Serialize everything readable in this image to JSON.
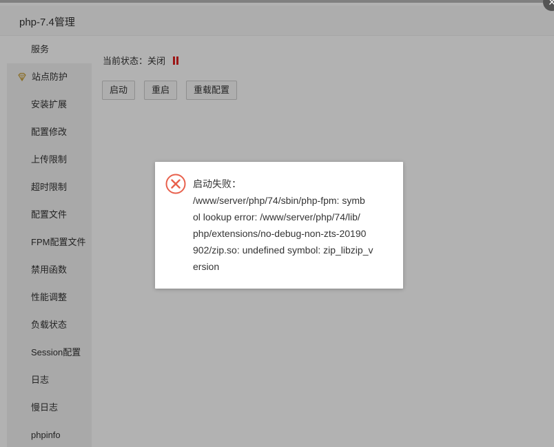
{
  "window": {
    "title": "php-7.4管理",
    "close_glyph": "×"
  },
  "sidebar": {
    "items": [
      {
        "label": "服务"
      },
      {
        "label": "站点防护"
      },
      {
        "label": "安装扩展"
      },
      {
        "label": "配置修改"
      },
      {
        "label": "上传限制"
      },
      {
        "label": "超时限制"
      },
      {
        "label": "配置文件"
      },
      {
        "label": "FPM配置文件"
      },
      {
        "label": "禁用函数"
      },
      {
        "label": "性能调整"
      },
      {
        "label": "负载状态"
      },
      {
        "label": "Session配置"
      },
      {
        "label": "日志"
      },
      {
        "label": "慢日志"
      },
      {
        "label": "phpinfo"
      }
    ]
  },
  "service": {
    "status_label": "当前状态：",
    "status_value": "关闭",
    "status_icon": "pause-icon",
    "status_color": "#e02020",
    "buttons": {
      "start": "启动",
      "restart": "重启",
      "reload": "重载配置"
    }
  },
  "dialog": {
    "icon": "error-circle-icon",
    "icon_color": "#e8604c",
    "lines": [
      "启动失败：",
      "/www/server/php/74/sbin/php-fpm: symb",
      "ol lookup error: /www/server/php/74/lib/",
      "php/extensions/no-debug-non-zts-20190",
      "902/zip.so: undefined symbol: zip_libzip_v",
      "ersion"
    ]
  },
  "colors": {
    "brand_green": "#20a53a",
    "sidebar_bg": "#f2f2f2",
    "overlay": "rgba(0,0,0,0.3)"
  }
}
